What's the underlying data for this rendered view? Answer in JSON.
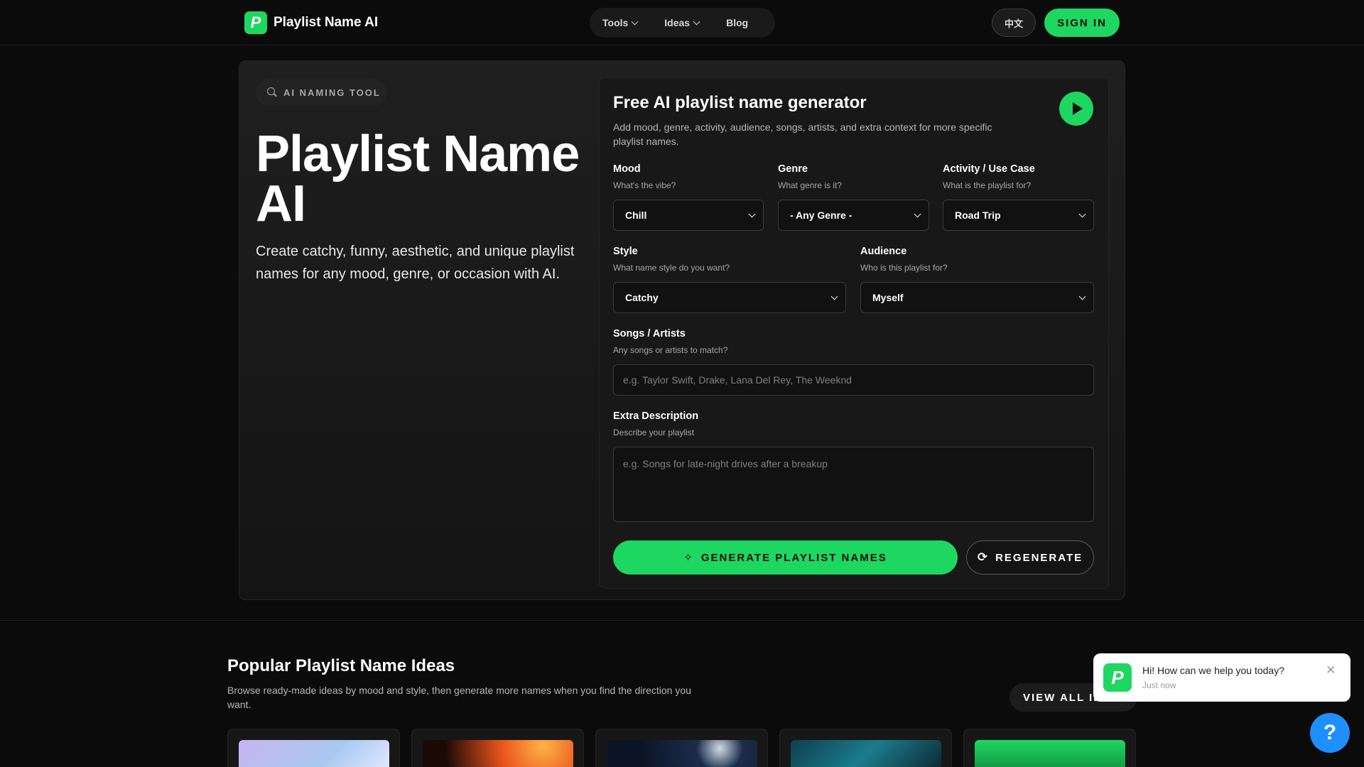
{
  "header": {
    "brand_letter": "P",
    "brand_name": "Playlist Name AI",
    "nav": [
      {
        "label": "Tools",
        "has_dropdown": true
      },
      {
        "label": "Ideas",
        "has_dropdown": true
      },
      {
        "label": "Blog",
        "has_dropdown": false
      }
    ],
    "lang_label": "中文",
    "signin_label": "SIGN IN"
  },
  "hero": {
    "tag_label": "AI NAMING TOOL",
    "title": "Playlist Name AI",
    "subtitle": "Create catchy, funny, aesthetic, and unique playlist names for any mood, genre, or occasion with AI."
  },
  "form": {
    "title": "Free AI playlist name generator",
    "description": "Add mood, genre, activity, audience, songs, artists, and extra context for more specific playlist names.",
    "mood": {
      "label": "Mood",
      "help": "What's the vibe?",
      "value": "Chill"
    },
    "genre": {
      "label": "Genre",
      "help": "What genre is it?",
      "value": "- Any Genre -"
    },
    "activity": {
      "label": "Activity / Use Case",
      "help": "What is the playlist for?",
      "value": "Road Trip"
    },
    "style": {
      "label": "Style",
      "help": "What name style do you want?",
      "value": "Catchy"
    },
    "audience": {
      "label": "Audience",
      "help": "Who is this playlist for?",
      "value": "Myself"
    },
    "songs": {
      "label": "Songs / Artists",
      "help": "Any songs or artists to match?",
      "placeholder": "e.g. Taylor Swift, Drake, Lana Del Rey, The Weeknd"
    },
    "extra": {
      "label": "Extra Description",
      "help": "Describe your playlist",
      "placeholder": "e.g. Songs for late-night drives after a breakup"
    },
    "generate_label": "GENERATE PLAYLIST NAMES",
    "regenerate_label": "REGENERATE"
  },
  "popular": {
    "title": "Popular Playlist Name Ideas",
    "description": "Browse ready-made ideas by mood and style, then generate more names when you find the direction you want.",
    "view_all_label": "VIEW ALL IDEAS"
  },
  "chat": {
    "message": "Hi! How can we help you today?",
    "time": "Just now",
    "help_symbol": "?"
  },
  "colors": {
    "accent": "#1ed760",
    "background": "#0b0b0b",
    "help_button": "#1e8fff"
  }
}
